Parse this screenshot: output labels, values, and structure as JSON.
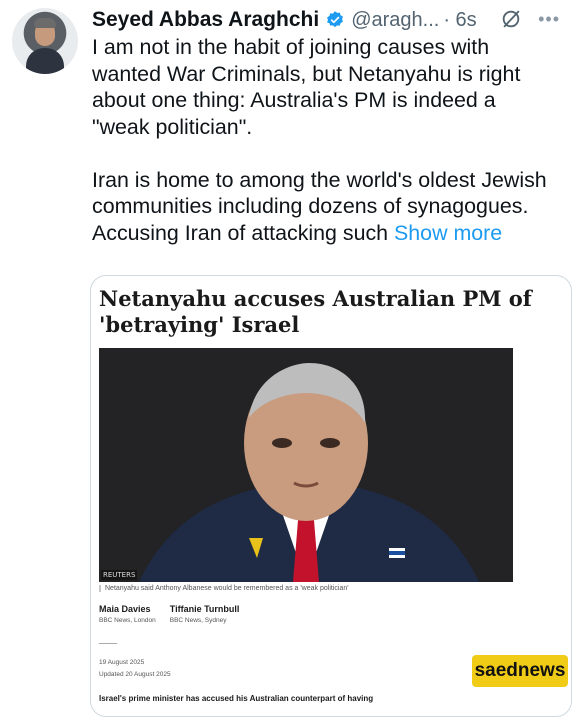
{
  "tweet": {
    "author_name": "Seyed Abbas Araghchi",
    "handle": "@aragh...",
    "time": "· 6s",
    "more_icon": "more-dots-icon",
    "grok_icon": "grok-icon",
    "text": "I am not in the habit of joining causes with\nwanted War Criminals, but Netanyahu is right\nabout one thing: Australia's PM is indeed a\n\"weak politician\".\n\nIran is home to among the world's oldest Jewish\ncommunities including dozens of synagogues.\nAccusing Iran of attacking such ",
    "show_more": "Show more"
  },
  "card": {
    "headline": "Netanyahu accuses Australian PM of 'betraying' Israel",
    "image_credit": "REUTERS",
    "caption": "Netanyahu said Anthony Albanese would be remembered as a 'weak politician'",
    "authors": [
      {
        "name": "Maia Davies",
        "desk": "BBC News, London"
      },
      {
        "name": "Tiffanie Turnbull",
        "desk": "BBC News, Sydney"
      }
    ],
    "published": "19 August 2025",
    "updated": "Updated 20 August 2025",
    "lede": "Israel's prime minister has accused his Australian counterpart of having"
  },
  "watermark": "saednews",
  "colors": {
    "link": "#1d9bf0",
    "muted": "#536471",
    "watermark_bg": "#f0cc16"
  }
}
